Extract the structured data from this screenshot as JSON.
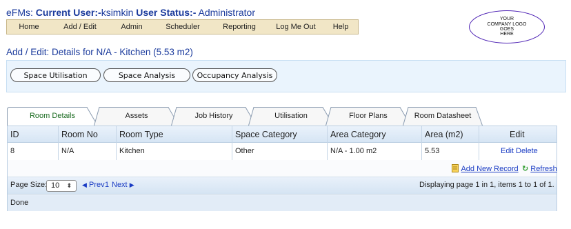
{
  "header": {
    "app": "eFMs:",
    "current_user_label": "Current User:-",
    "current_user": "ksimkin",
    "user_status_label": "User Status:-",
    "user_status": "Administrator"
  },
  "menu": [
    "Home",
    "Add / Edit",
    "Admin",
    "Scheduler",
    "Reporting",
    "Log Me Out",
    "Help"
  ],
  "logo": {
    "line1": "YOUR",
    "line2": "COMPANY LOGO",
    "line3": "GOES",
    "line4": "HERE"
  },
  "page_title": "Add / Edit: Details for N/A - Kitchen (5.53 m2)",
  "toolbar": [
    "Space Utilisation",
    "Space Analysis",
    "Occupancy Analysis"
  ],
  "tabs": [
    "Room Details",
    "Assets",
    "Job History",
    "Utilisation",
    "Floor Plans",
    "Room Datasheet"
  ],
  "table": {
    "columns": [
      "ID",
      "Room No",
      "Room Type",
      "Space Category",
      "Area Category",
      "Area (m2)",
      "Edit"
    ],
    "rows": [
      {
        "id": "8",
        "room_no": "N/A",
        "room_type": "Kitchen",
        "space_category": "Other",
        "area_category": "N/A - 1.00 m2",
        "area": "5.53",
        "edit": "Edit",
        "delete": "Delete"
      }
    ],
    "add_new": "Add New Record",
    "refresh": "Refresh"
  },
  "pager": {
    "page_size_label": "Page Size:",
    "page_size": "10",
    "prev": "Prev",
    "page": "1",
    "next": "Next",
    "summary": "Displaying page 1 in 1, items 1 to 1 of 1."
  },
  "status": "Done",
  "colors": {
    "accent": "#1a3a9c",
    "menu_bg": "#f1e6c6",
    "tab_active_text": "#1a6b20",
    "link": "#1a3cc4"
  }
}
